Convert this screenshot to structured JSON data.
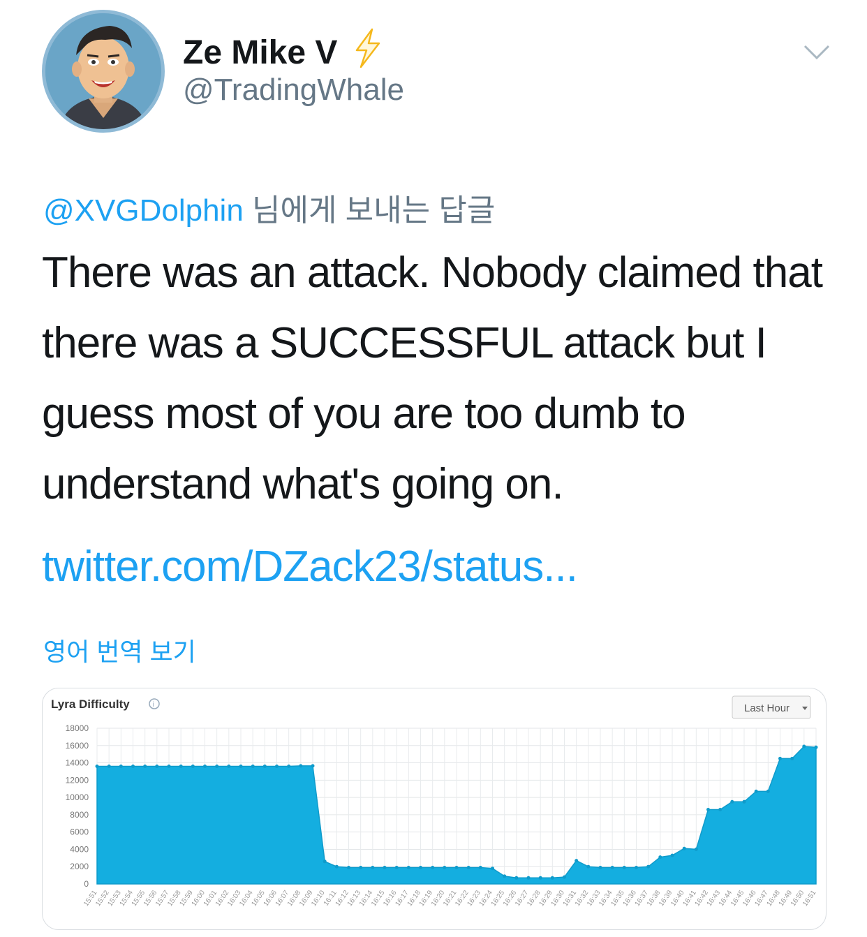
{
  "user": {
    "display_name": "Ze Mike V",
    "handle": "@TradingWhale"
  },
  "reply": {
    "mention": "@XVGDolphin",
    "suffix": " 님에게 보내는 답글"
  },
  "tweet": {
    "text": "There was an attack. Nobody claimed that there was a SUCCESSFUL attack but I guess most of you are too dumb to understand what's going on.",
    "link": "twitter.com/DZack23/status..."
  },
  "translate_label": "영어 번역 보기",
  "colors": {
    "accent": "#1da1f2",
    "secondary_text": "#657786",
    "chart_fill": "#14aee0",
    "bolt": "#f5b81c"
  },
  "icons": [
    "lightning-bolt-icon",
    "chevron-down-icon",
    "info-icon",
    "caret-down-icon"
  ],
  "chart_data": {
    "type": "area",
    "title": "Lyra Difficulty",
    "range_selector": "Last Hour",
    "ylim": [
      0,
      18000
    ],
    "y_ticks": [
      "18000",
      "16000",
      "14000",
      "12000",
      "10000",
      "8000",
      "6000",
      "4000",
      "2000",
      "0"
    ],
    "categories": [
      "15:51",
      "15:52",
      "15:53",
      "15:54",
      "15:55",
      "15:56",
      "15:57",
      "15:58",
      "15:59",
      "16:00",
      "16:01",
      "16:02",
      "16:03",
      "16:04",
      "16:05",
      "16:06",
      "16:07",
      "16:08",
      "16:09",
      "16:10",
      "16:11",
      "16:12",
      "16:13",
      "16:14",
      "16:15",
      "16:16",
      "16:17",
      "16:18",
      "16:19",
      "16:20",
      "16:21",
      "16:22",
      "16:23",
      "16:24",
      "16:25",
      "16:26",
      "16:27",
      "16:28",
      "16:29",
      "16:30",
      "16:31",
      "16:32",
      "16:33",
      "16:34",
      "16:35",
      "16:36",
      "16:37",
      "16:38",
      "16:39",
      "16:40",
      "16:41",
      "16:42",
      "16:43",
      "16:44",
      "16:45",
      "16:46",
      "16:47",
      "16:48",
      "16:49",
      "16:50",
      "16:51"
    ],
    "values": [
      13600,
      13600,
      13600,
      13600,
      13600,
      13600,
      13600,
      13600,
      13600,
      13600,
      13600,
      13600,
      13600,
      13600,
      13600,
      13600,
      13600,
      13650,
      13650,
      2600,
      2000,
      1900,
      1900,
      1900,
      1900,
      1900,
      1900,
      1900,
      1900,
      1900,
      1900,
      1900,
      1900,
      1800,
      900,
      700,
      700,
      700,
      700,
      800,
      2700,
      2000,
      1900,
      1900,
      1900,
      1900,
      2000,
      3100,
      3300,
      4100,
      4000,
      8600,
      8600,
      9500,
      9500,
      10700,
      10700,
      14500,
      14500,
      15900,
      15800
    ],
    "grid": true,
    "legend": "none"
  }
}
